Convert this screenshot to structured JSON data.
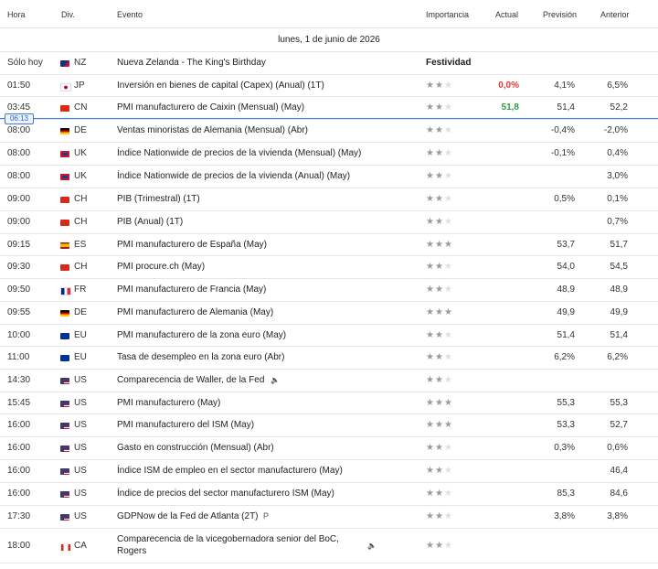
{
  "headers": {
    "hora": "Hora",
    "div": "Div.",
    "evento": "Evento",
    "importancia": "Importancia",
    "actual": "Actual",
    "prevision": "Previsión",
    "anterior": "Anterior"
  },
  "day_label": "lunes, 1 de junio de 2026",
  "current_time": "06:13",
  "colors": {
    "actual_negative": "#e53935",
    "actual_positive": "#2e9e3e",
    "now_line": "#3d7be0"
  },
  "rows": [
    {
      "time": "Sólo hoy",
      "ccy": "NZ",
      "flag": "NZ",
      "event": "Nueva Zelanda - The King's Birthday",
      "holiday": "Festividad",
      "stars": 0,
      "actual": "",
      "actual_color": "",
      "prev": "",
      "ant": ""
    },
    {
      "time": "01:50",
      "ccy": "JP",
      "flag": "JP",
      "event": "Inversión en bienes de capital (Capex) (Anual) (1T)",
      "holiday": "",
      "stars": 2,
      "actual": "0,0%",
      "actual_color": "#e53935",
      "prev": "4,1%",
      "ant": "6,5%"
    },
    {
      "time": "03:45",
      "ccy": "CN",
      "flag": "CN",
      "event": "PMI manufacturero de Caixin (Mensual) (May)",
      "holiday": "",
      "stars": 2,
      "actual": "51,8",
      "actual_color": "#2e9e3e",
      "prev": "51,4",
      "ant": "52,2"
    },
    {
      "time": "08:00",
      "ccy": "DE",
      "flag": "DE",
      "event": "Ventas minoristas de Alemania (Mensual) (Abr)",
      "holiday": "",
      "stars": 2,
      "actual": "",
      "actual_color": "",
      "prev": "-0,4%",
      "ant": "-2,0%"
    },
    {
      "time": "08:00",
      "ccy": "UK",
      "flag": "UK",
      "event": "Índice Nationwide de precios de la vivienda (Mensual) (May)",
      "holiday": "",
      "stars": 2,
      "actual": "",
      "actual_color": "",
      "prev": "-0,1%",
      "ant": "0,4%"
    },
    {
      "time": "08:00",
      "ccy": "UK",
      "flag": "UK",
      "event": "Índice Nationwide de precios de la vivienda (Anual) (May)",
      "holiday": "",
      "stars": 2,
      "actual": "",
      "actual_color": "",
      "prev": "",
      "ant": "3,0%"
    },
    {
      "time": "09:00",
      "ccy": "CH",
      "flag": "CH",
      "event": "PIB (Trimestral) (1T)",
      "holiday": "",
      "stars": 2,
      "actual": "",
      "actual_color": "",
      "prev": "0,5%",
      "ant": "0,1%"
    },
    {
      "time": "09:00",
      "ccy": "CH",
      "flag": "CH",
      "event": "PIB (Anual) (1T)",
      "holiday": "",
      "stars": 2,
      "actual": "",
      "actual_color": "",
      "prev": "",
      "ant": "0,7%"
    },
    {
      "time": "09:15",
      "ccy": "ES",
      "flag": "ES",
      "event": "PMI manufacturero de España  (May)",
      "holiday": "",
      "stars": 3,
      "actual": "",
      "actual_color": "",
      "prev": "53,7",
      "ant": "51,7"
    },
    {
      "time": "09:30",
      "ccy": "CH",
      "flag": "CH",
      "event": "PMI procure.ch  (May)",
      "holiday": "",
      "stars": 2,
      "actual": "",
      "actual_color": "",
      "prev": "54,0",
      "ant": "54,5"
    },
    {
      "time": "09:50",
      "ccy": "FR",
      "flag": "FR",
      "event": "PMI manufacturero de Francia  (May)",
      "holiday": "",
      "stars": 2,
      "actual": "",
      "actual_color": "",
      "prev": "48,9",
      "ant": "48,9"
    },
    {
      "time": "09:55",
      "ccy": "DE",
      "flag": "DE",
      "event": "PMI manufacturero de Alemania  (May)",
      "holiday": "",
      "stars": 3,
      "actual": "",
      "actual_color": "",
      "prev": "49,9",
      "ant": "49,9"
    },
    {
      "time": "10:00",
      "ccy": "EU",
      "flag": "EU",
      "event": "PMI manufacturero de la zona euro  (May)",
      "holiday": "",
      "stars": 2,
      "actual": "",
      "actual_color": "",
      "prev": "51,4",
      "ant": "51,4"
    },
    {
      "time": "11:00",
      "ccy": "EU",
      "flag": "EU",
      "event": "Tasa de desempleo en la zona euro  (Abr)",
      "holiday": "",
      "stars": 2,
      "actual": "",
      "actual_color": "",
      "prev": "6,2%",
      "ant": "6,2%"
    },
    {
      "time": "14:30",
      "ccy": "US",
      "flag": "US",
      "event": "Comparecencia de Waller, de la Fed",
      "holiday": "",
      "stars": 2,
      "actual": "",
      "actual_color": "",
      "prev": "",
      "ant": "",
      "icon": "speaker-icon"
    },
    {
      "time": "15:45",
      "ccy": "US",
      "flag": "US",
      "event": "PMI manufacturero  (May)",
      "holiday": "",
      "stars": 3,
      "actual": "",
      "actual_color": "",
      "prev": "55,3",
      "ant": "55,3"
    },
    {
      "time": "16:00",
      "ccy": "US",
      "flag": "US",
      "event": "PMI manufacturero del ISM  (May)",
      "holiday": "",
      "stars": 3,
      "actual": "",
      "actual_color": "",
      "prev": "53,3",
      "ant": "52,7"
    },
    {
      "time": "16:00",
      "ccy": "US",
      "flag": "US",
      "event": "Gasto en construcción (Mensual) (Abr)",
      "holiday": "",
      "stars": 2,
      "actual": "",
      "actual_color": "",
      "prev": "0,3%",
      "ant": "0,6%"
    },
    {
      "time": "16:00",
      "ccy": "US",
      "flag": "US",
      "event": "Índice ISM de empleo en el sector manufacturero  (May)",
      "holiday": "",
      "stars": 2,
      "actual": "",
      "actual_color": "",
      "prev": "",
      "ant": "46,4"
    },
    {
      "time": "16:00",
      "ccy": "US",
      "flag": "US",
      "event": "Índice de precios del sector manufacturero ISM  (May)",
      "holiday": "",
      "stars": 2,
      "actual": "",
      "actual_color": "",
      "prev": "85,3",
      "ant": "84,6"
    },
    {
      "time": "17:30",
      "ccy": "US",
      "flag": "US",
      "event": "GDPNow de la Fed de Atlanta  (2T)",
      "holiday": "",
      "stars": 2,
      "actual": "",
      "actual_color": "",
      "prev": "3,8%",
      "ant": "3,8%",
      "icon": "preliminary-icon",
      "icon_text": "P"
    },
    {
      "time": "18:00",
      "ccy": "CA",
      "flag": "CA",
      "event": "Comparecencia de la vicegobernadora senior del BoC,",
      "event2": "Rogers",
      "holiday": "",
      "stars": 2,
      "actual": "",
      "actual_color": "",
      "prev": "",
      "ant": "",
      "icon": "speaker-icon"
    }
  ]
}
